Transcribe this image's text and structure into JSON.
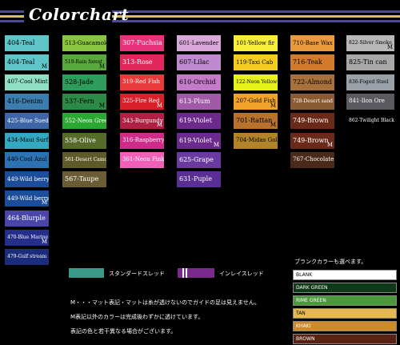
{
  "header": {
    "title": "Colorchart",
    "stripe_colors": [
      "#4b4b9c",
      "#d8c25a",
      "#4b4b9c"
    ]
  },
  "swatches": [
    {
      "label": "404-Teal",
      "color": "#5fc5c9",
      "text_color": "#000000",
      "m": false
    },
    {
      "label": "404-Teal",
      "color": "#5fc5c9",
      "text_color": "#000000",
      "m": true
    },
    {
      "label": "407-Cool Mint",
      "color": "#8fe0c4",
      "text_color": "#000000",
      "m": false
    },
    {
      "label": "416-Denim",
      "color": "#3c7db0",
      "text_color": "#000000",
      "m": false
    },
    {
      "label": "425-Blue Suede",
      "color": "#3d65a8",
      "text_color": "#ffffff",
      "m": false
    },
    {
      "label": "434-Maui Surf",
      "color": "#33a8c1",
      "text_color": "#000000",
      "m": false
    },
    {
      "label": "440-Cool Azul",
      "color": "#2c72b2",
      "text_color": "#000000",
      "m": false
    },
    {
      "label": "449-Wild berry",
      "color": "#1c4d9a",
      "text_color": "#ffffff",
      "m": false
    },
    {
      "label": "449-Wild berry",
      "color": "#1c4d9a",
      "text_color": "#ffffff",
      "m": true
    },
    {
      "label": "464-Blurple",
      "color": "#4a45a8",
      "text_color": "#ffffff",
      "m": false
    },
    {
      "label": "470-Blue Marine",
      "color": "#232f8a",
      "text_color": "#ffffff",
      "m": true
    },
    {
      "label": "479-Gulf stream",
      "color": "#1a2c7a",
      "text_color": "#ffffff",
      "m": false
    },
    {
      "label": "513-Guacamole",
      "color": "#8bc43e",
      "text_color": "#000000",
      "m": false
    },
    {
      "label": "519-Rain forest",
      "color": "#58a83c",
      "text_color": "#000000",
      "m": true
    },
    {
      "label": "528-Jade",
      "color": "#2d9c5c",
      "text_color": "#000000",
      "m": false
    },
    {
      "label": "537-Fern",
      "color": "#2c8a46",
      "text_color": "#000000",
      "m": true
    },
    {
      "label": "552-Neon Green",
      "color": "#2aa832",
      "text_color": "#ffffff",
      "m": false
    },
    {
      "label": "558-Olive",
      "color": "#566b2a",
      "text_color": "#ffffff",
      "m": false
    },
    {
      "label": "561-Desert Camo",
      "color": "#5f5a2a",
      "text_color": "#ffffff",
      "m": false
    },
    {
      "label": "567-Taupe",
      "color": "#6b5c35",
      "text_color": "#ffffff",
      "m": false
    },
    {
      "label": "307-Fuchsia",
      "color": "#e8337a",
      "text_color": "#ffffff",
      "m": false
    },
    {
      "label": "313-Rose",
      "color": "#e0265a",
      "text_color": "#ffffff",
      "m": false
    },
    {
      "label": "319-Red Fish",
      "color": "#e83a3a",
      "text_color": "#ffffff",
      "m": false
    },
    {
      "label": "325-Fire Red",
      "color": "#d8202a",
      "text_color": "#ffffff",
      "m": true
    },
    {
      "label": "343-Burgundy",
      "color": "#b02045",
      "text_color": "#ffffff",
      "m": true
    },
    {
      "label": "316-Raspberry",
      "color": "#d02a8a",
      "text_color": "#ffffff",
      "m": false
    },
    {
      "label": "361-Neon Pink",
      "color": "#f060b8",
      "text_color": "#ffffff",
      "m": false
    },
    {
      "label": "601-Lavender",
      "color": "#d8a8d8",
      "text_color": "#000000",
      "m": false
    },
    {
      "label": "607-Lilac",
      "color": "#c08ad0",
      "text_color": "#000000",
      "m": false
    },
    {
      "label": "610-Orchid",
      "color": "#c37ac8",
      "text_color": "#000000",
      "m": false
    },
    {
      "label": "613-Plum",
      "color": "#a05aa8",
      "text_color": "#ffffff",
      "m": false
    },
    {
      "label": "619-Violet",
      "color": "#6c2a8c",
      "text_color": "#ffffff",
      "m": false
    },
    {
      "label": "619-Violet",
      "color": "#6c2a8c",
      "text_color": "#ffffff",
      "m": true
    },
    {
      "label": "625-Grape",
      "color": "#6a3aa0",
      "text_color": "#ffffff",
      "m": false
    },
    {
      "label": "631-Puple",
      "color": "#5a2e92",
      "text_color": "#ffffff",
      "m": false
    },
    {
      "label": "101-Yellow fir",
      "color": "#f6ee3a",
      "text_color": "#000000",
      "m": false
    },
    {
      "label": "119-Taxi Cab",
      "color": "#f4cc22",
      "text_color": "#000000",
      "m": false
    },
    {
      "label": "122-Neon Yellow",
      "color": "#e6f21a",
      "text_color": "#000000",
      "m": false
    },
    {
      "label": "207-Gold Fish",
      "color": "#f0a22a",
      "text_color": "#000000",
      "m": true
    },
    {
      "label": "701-Rattan",
      "color": "#b8722e",
      "text_color": "#000000",
      "m": true
    },
    {
      "label": "704-Midas Gold",
      "color": "#b2842a",
      "text_color": "#000000",
      "m": false
    },
    {
      "label": "710-Base Wax",
      "color": "#e89a3c",
      "text_color": "#000000",
      "m": false
    },
    {
      "label": "716-Teak",
      "color": "#d07a2a",
      "text_color": "#000000",
      "m": false
    },
    {
      "label": "722-Almond",
      "color": "#a8703a",
      "text_color": "#000000",
      "m": false
    },
    {
      "label": "728-Desert sand",
      "color": "#8a5a32",
      "text_color": "#ffffff",
      "m": false
    },
    {
      "label": "749-Brown",
      "color": "#6a2a1a",
      "text_color": "#ffffff",
      "m": false
    },
    {
      "label": "749-Brown",
      "color": "#6a2a1a",
      "text_color": "#ffffff",
      "m": true
    },
    {
      "label": "767-Chocolate",
      "color": "#4a2a1a",
      "text_color": "#ffffff",
      "m": false
    },
    {
      "label": "822-Silver Smoke",
      "color": "#b8b8b8",
      "text_color": "#000000",
      "m": true
    },
    {
      "label": "825-Tin can",
      "color": "#a8a8a8",
      "text_color": "#000000",
      "m": false
    },
    {
      "label": "836-Foged Steel",
      "color": "#9aa0a8",
      "text_color": "#000000",
      "m": false
    },
    {
      "label": "841-Ilon Ore",
      "color": "#5a5a60",
      "text_color": "#ffffff",
      "m": false
    },
    {
      "label": "862-Twilight Black",
      "color": "#000000",
      "text_color": "#ffffff",
      "m": false
    }
  ],
  "legend": {
    "standard_label": "スタンダードスレッド",
    "standard_color": "#3a9a8a",
    "inlay_label": "インレイスレッド",
    "inlay_color": "#7a2a8a"
  },
  "notes": [
    "M・・・マット表記・マットは糸が透けないのでガイドの足は見えません。",
    "M表記以外のカラーは完成後わずかに透けています。",
    "表記の色と若干異なる場合がございます。"
  ],
  "blank_section": {
    "heading": "ブランクカラーも選べます。",
    "items": [
      {
        "label": "BLANK",
        "color": "#ffffff",
        "text_color": "#000000"
      },
      {
        "label": "DARK GREEN",
        "color": "#0f3a1a",
        "text_color": "#ffffff"
      },
      {
        "label": "RIME GREEN",
        "color": "#4a9a3a",
        "text_color": "#ffffff"
      },
      {
        "label": "TAN",
        "color": "#e8b84a",
        "text_color": "#000000"
      },
      {
        "label": "KHAKI",
        "color": "#d08a2a",
        "text_color": "#ffffff"
      },
      {
        "label": "BROWN",
        "color": "#5a2212",
        "text_color": "#ffffff"
      }
    ]
  }
}
